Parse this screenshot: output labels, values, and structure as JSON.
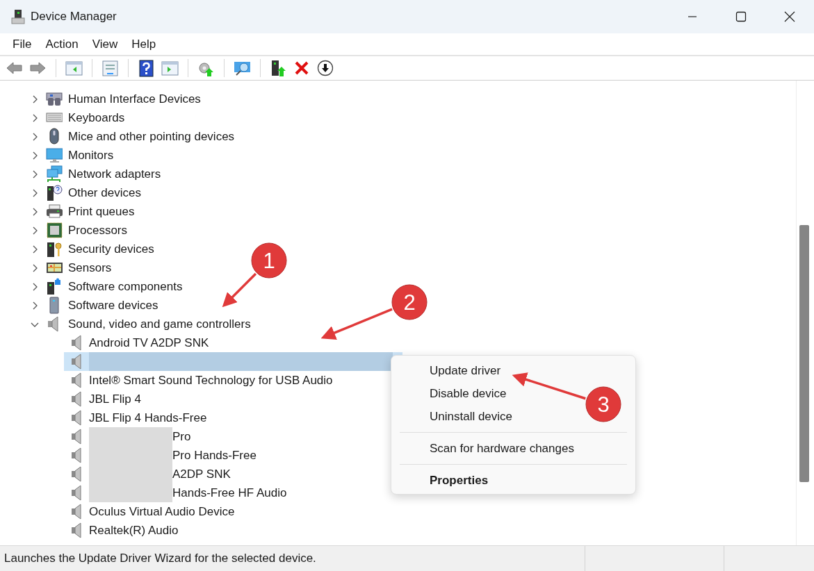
{
  "window": {
    "title": "Device Manager"
  },
  "menu": [
    "File",
    "Action",
    "View",
    "Help"
  ],
  "tree": [
    {
      "name": "Human Interface Devices",
      "expanded": false
    },
    {
      "name": "Keyboards",
      "expanded": false
    },
    {
      "name": "Mice and other pointing devices",
      "expanded": false
    },
    {
      "name": "Monitors",
      "expanded": false
    },
    {
      "name": "Network adapters",
      "expanded": false
    },
    {
      "name": "Other devices",
      "expanded": false
    },
    {
      "name": "Print queues",
      "expanded": false
    },
    {
      "name": "Processors",
      "expanded": false
    },
    {
      "name": "Security devices",
      "expanded": false
    },
    {
      "name": "Sensors",
      "expanded": false
    },
    {
      "name": "Software components",
      "expanded": false
    },
    {
      "name": "Software devices",
      "expanded": false
    },
    {
      "name": "Sound, video and game controllers",
      "expanded": true,
      "children": [
        {
          "name": "Android TV A2DP SNK",
          "selected": false,
          "redacted": false
        },
        {
          "selected": true,
          "redacted": true
        },
        {
          "name": "Intel® Smart Sound Technology for USB Audio",
          "selected": false,
          "redacted": false
        },
        {
          "name": "JBL Flip 4",
          "selected": false,
          "redacted": false
        },
        {
          "name": "JBL Flip 4 Hands-Free",
          "selected": false,
          "redacted": false
        },
        {
          "name": "Pro",
          "selected": false,
          "redacted": true
        },
        {
          "name": "Pro Hands-Free",
          "selected": false,
          "redacted": true
        },
        {
          "name": "A2DP SNK",
          "selected": false,
          "redacted": true
        },
        {
          "name": "Hands-Free HF Audio",
          "selected": false,
          "redacted": true
        },
        {
          "name": "Oculus Virtual Audio Device",
          "selected": false,
          "redacted": false
        },
        {
          "name": "Realtek(R) Audio",
          "selected": false,
          "redacted": false
        }
      ]
    }
  ],
  "context_menu": {
    "items": [
      {
        "kind": "item",
        "label": "Update driver",
        "default": false
      },
      {
        "kind": "item",
        "label": "Disable device",
        "default": false
      },
      {
        "kind": "item",
        "label": "Uninstall device",
        "default": false
      },
      {
        "kind": "separator"
      },
      {
        "kind": "item",
        "label": "Scan for hardware changes",
        "default": false
      },
      {
        "kind": "separator"
      },
      {
        "kind": "item",
        "label": "Properties",
        "default": true
      }
    ]
  },
  "status_bar": {
    "text": "Launches the Update Driver Wizard for the selected device."
  },
  "annotations": [
    {
      "number": "1"
    },
    {
      "number": "2"
    },
    {
      "number": "3"
    }
  ]
}
